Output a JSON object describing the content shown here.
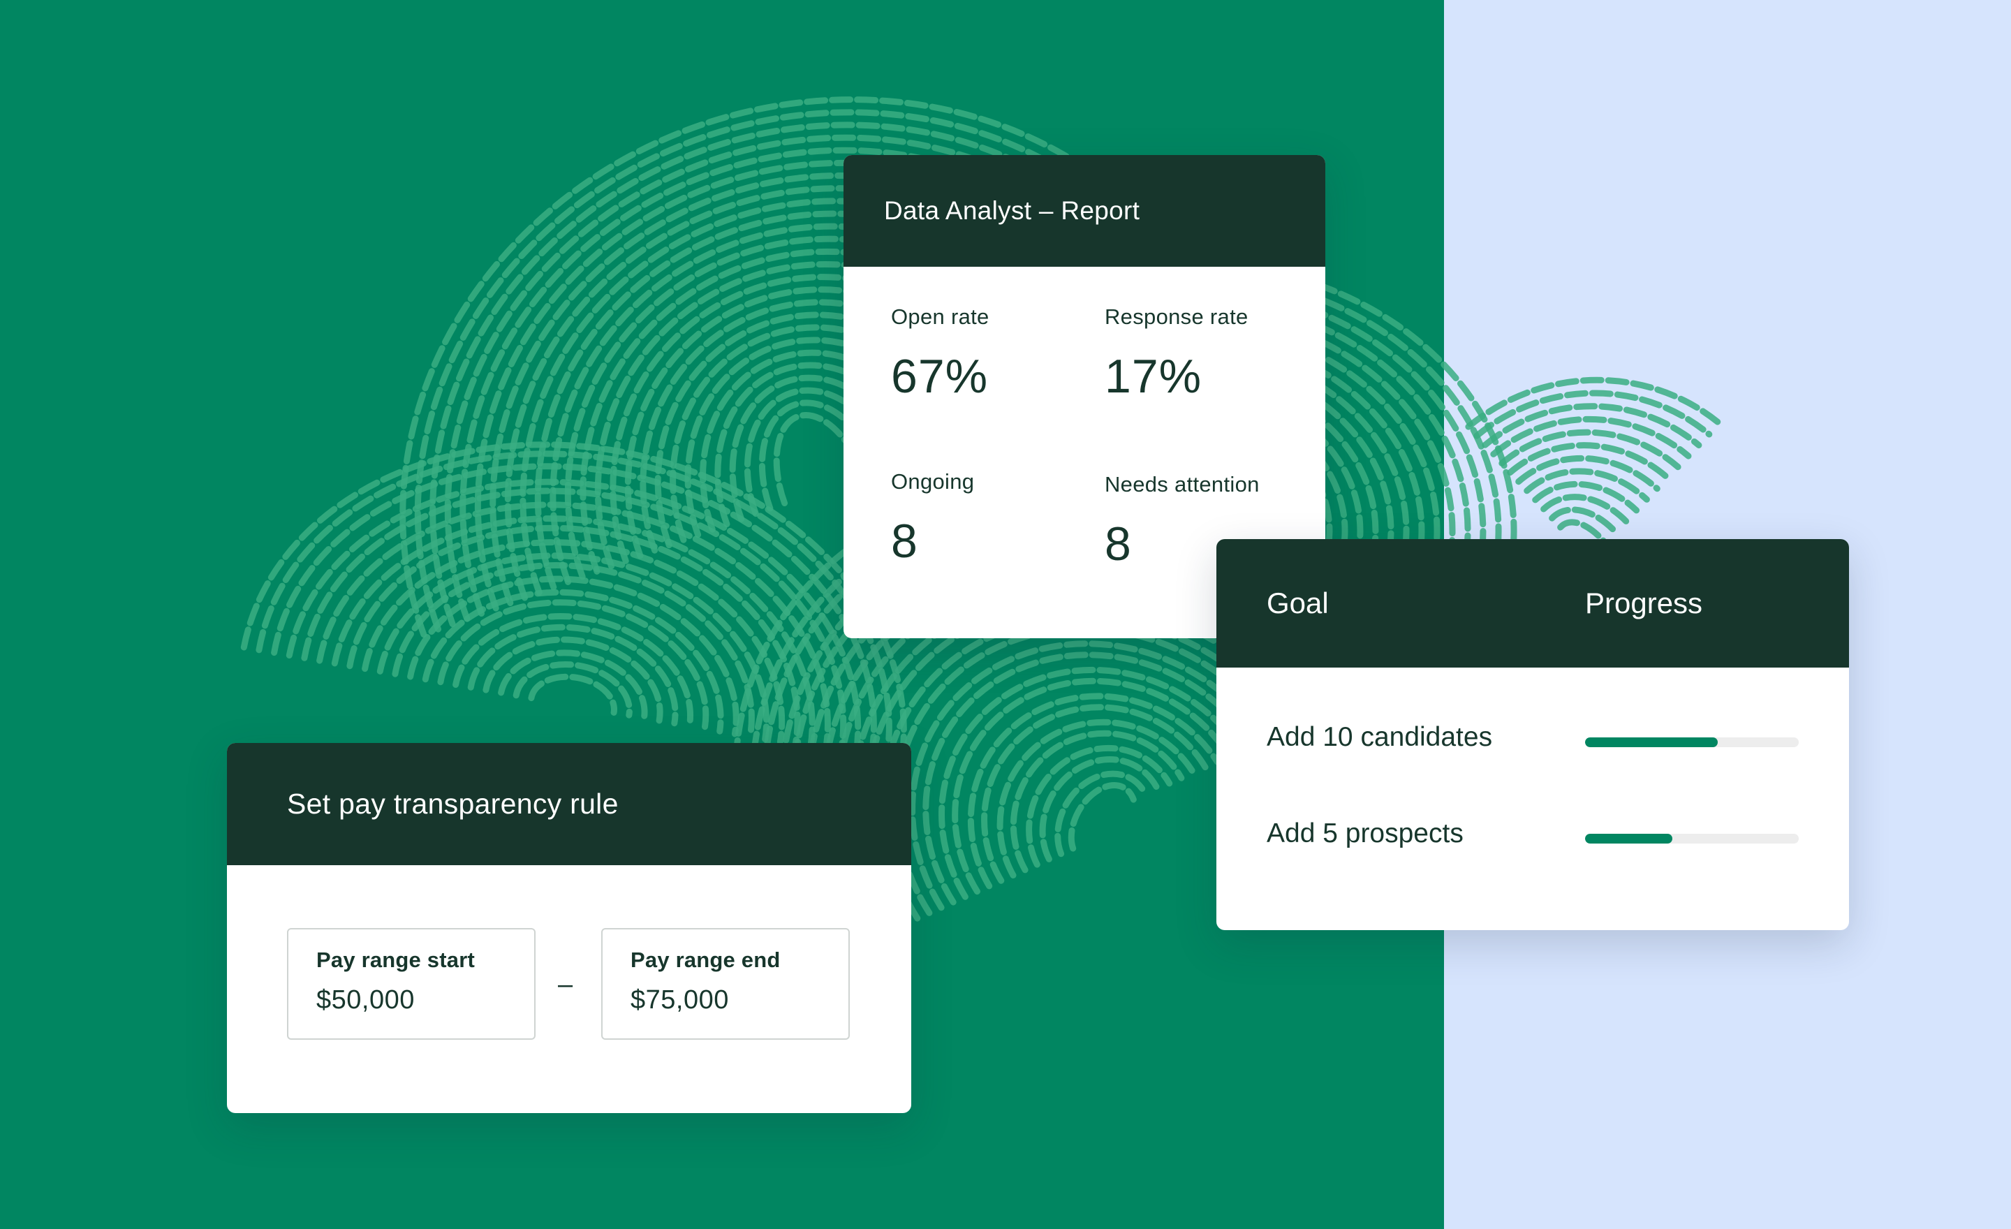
{
  "colors": {
    "green_bg": "#018661",
    "blue_bg": "#d6e4fd",
    "header_dark": "#17362c",
    "progress_fill": "#018661",
    "progress_track": "#ededed"
  },
  "report_card": {
    "title": "Data Analyst – Report",
    "metrics": [
      {
        "label": "Open rate",
        "value": "67%"
      },
      {
        "label": "Response rate",
        "value": "17%"
      },
      {
        "label": "Ongoing",
        "value": "8"
      },
      {
        "label": "Needs attention",
        "value": "8"
      }
    ]
  },
  "goal_card": {
    "goal_header": "Goal",
    "progress_header": "Progress",
    "rows": [
      {
        "goal": "Add 10 candidates",
        "progress": 0.62
      },
      {
        "goal": "Add 5 prospects",
        "progress": 0.41
      }
    ]
  },
  "pay_card": {
    "title": "Set pay transparency rule",
    "start_label": "Pay range start",
    "start_value": "$50,000",
    "separator": "–",
    "end_label": "Pay range end",
    "end_value": "$75,000"
  }
}
